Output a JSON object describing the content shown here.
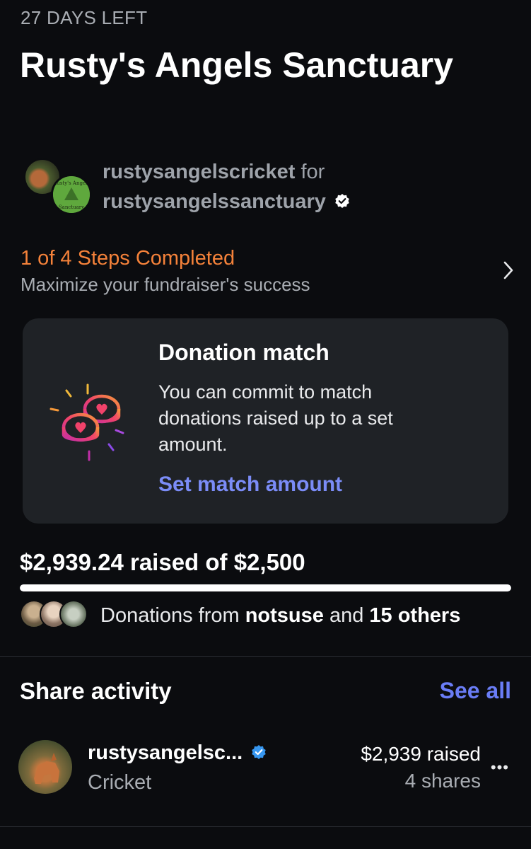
{
  "header": {
    "days_left": "27 DAYS LEFT",
    "title": "Rusty's Angels Sanctuary"
  },
  "organizer": {
    "user": "rustysangelscricket",
    "for_word": "for",
    "beneficiary": "rustysangelssanctuary",
    "avatar_logo_top": "Rusty's Angels",
    "avatar_logo_bottom": "Sanctuary"
  },
  "steps": {
    "title": "1 of 4 Steps Completed",
    "subtitle": "Maximize your fundraiser's success"
  },
  "match_card": {
    "title": "Donation match",
    "body": "You can commit to match donations raised up to a set amount.",
    "link": "Set match amount"
  },
  "progress": {
    "raised_text": "$2,939.24 raised of $2,500",
    "fraction": 1.0
  },
  "donations": {
    "prefix": "Donations from ",
    "first_donor": "notsuse",
    "middle": " and ",
    "others": "15 others"
  },
  "share_activity": {
    "title": "Share activity",
    "see_all": "See all",
    "items": [
      {
        "name": "rustysangelsc...",
        "subtitle": "Cricket",
        "amount": "$2,939 raised",
        "shares": "4 shares"
      }
    ]
  },
  "colors": {
    "background": "#0b0c0f",
    "accent_orange": "#f5823a",
    "link_blue": "#7b8cf7",
    "card_bg": "#1f2226",
    "verified_blue": "#3797f0"
  },
  "icons": {
    "verified": "verified-badge-icon",
    "chevron": "chevron-right-icon",
    "match": "coin-hearts-icon",
    "more": "more-horizontal-icon"
  }
}
